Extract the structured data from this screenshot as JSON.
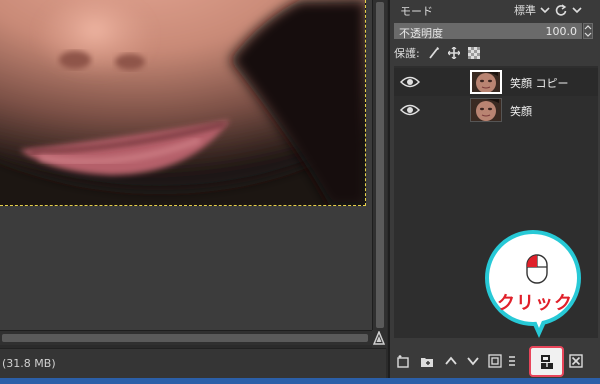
{
  "canvas": {
    "status_text": "(31.8 MB)"
  },
  "layers_panel": {
    "mode_label": "モード",
    "mode_value": "標準",
    "opacity_label": "不透明度",
    "opacity_value": "100.0",
    "opacity_percent": 100,
    "lock_label": "保護:",
    "layers": [
      {
        "name": "笑顔 コピー",
        "visible": true,
        "selected": true
      },
      {
        "name": "笑顔",
        "visible": true,
        "selected": false
      }
    ],
    "icons": [
      "new-layer-icon",
      "new-layer-group-icon",
      "raise-layer-icon",
      "lower-layer-icon",
      "duplicate-layer-icon",
      "anchor-icon",
      "merge-down-icon",
      "delete-layer-icon"
    ]
  },
  "callout": {
    "text": "クリック",
    "accent_color": "#27c9d6",
    "text_color": "#e0202a"
  }
}
